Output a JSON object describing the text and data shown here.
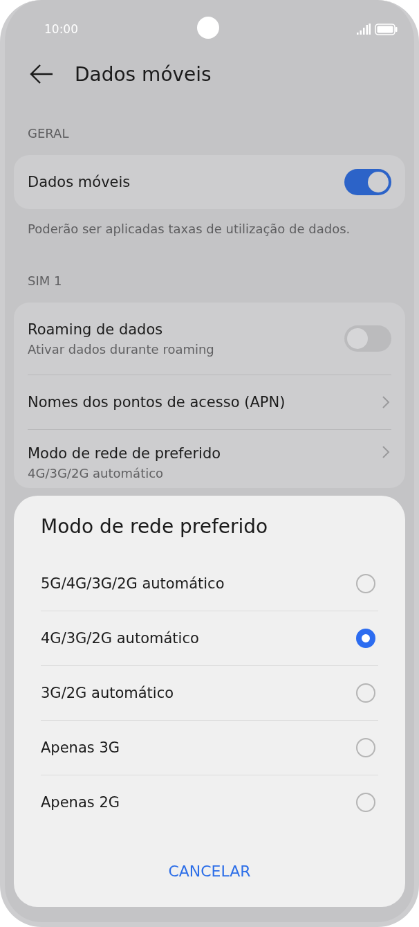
{
  "status_bar": {
    "time": "10:00"
  },
  "header": {
    "title": "Dados móveis"
  },
  "sections": [
    {
      "heading": "GERAL",
      "items": [
        {
          "kind": "toggle",
          "title": "Dados móveis",
          "on": true
        }
      ],
      "note": "Poderão ser aplicadas taxas de utilização de dados."
    },
    {
      "heading": "SIM 1",
      "items": [
        {
          "kind": "toggle",
          "title": "Roaming de dados",
          "subtitle": "Ativar dados durante roaming",
          "on": false
        },
        {
          "kind": "link",
          "title": "Nomes dos pontos de acesso (APN)"
        },
        {
          "kind": "link",
          "title": "Modo de rede de preferido",
          "subtitle": "4G/3G/2G automático"
        }
      ]
    }
  ],
  "dialog": {
    "title": "Modo de rede preferido",
    "options": [
      {
        "label": "5G/4G/3G/2G automático",
        "selected": false
      },
      {
        "label": "4G/3G/2G automático",
        "selected": true
      },
      {
        "label": "3G/2G automático",
        "selected": false
      },
      {
        "label": "Apenas 3G",
        "selected": false
      },
      {
        "label": "Apenas 2G",
        "selected": false
      }
    ],
    "cancel": "CANCELAR"
  }
}
